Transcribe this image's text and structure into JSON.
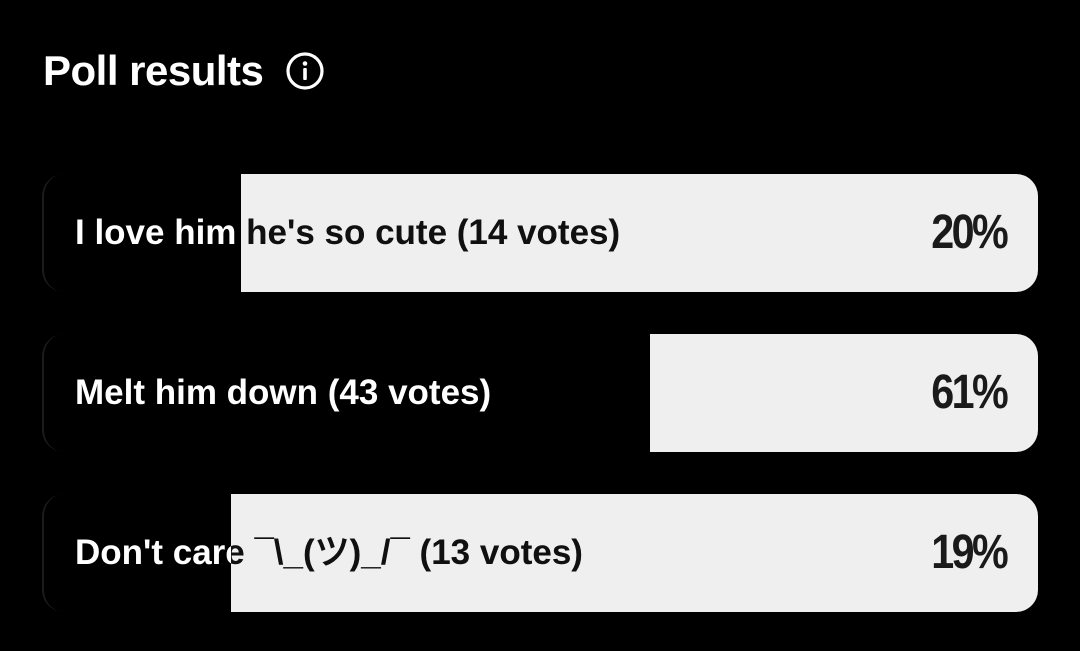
{
  "header": {
    "title": "Poll results",
    "info_icon": "info-icon"
  },
  "colors": {
    "background": "#000000",
    "bar_fill": "#efefef",
    "text_light": "#ffffff",
    "text_dark": "#1a1a1a"
  },
  "options": [
    {
      "label": "I love him he's so cute (14 votes)",
      "percent_label": "20%",
      "percent": 20,
      "votes": 14
    },
    {
      "label": "Melt him down (43 votes)",
      "percent_label": "61%",
      "percent": 61,
      "votes": 43
    },
    {
      "label": "Don't care ¯\\_(ツ)_/¯ (13 votes)",
      "percent_label": "19%",
      "percent": 19,
      "votes": 13
    }
  ]
}
